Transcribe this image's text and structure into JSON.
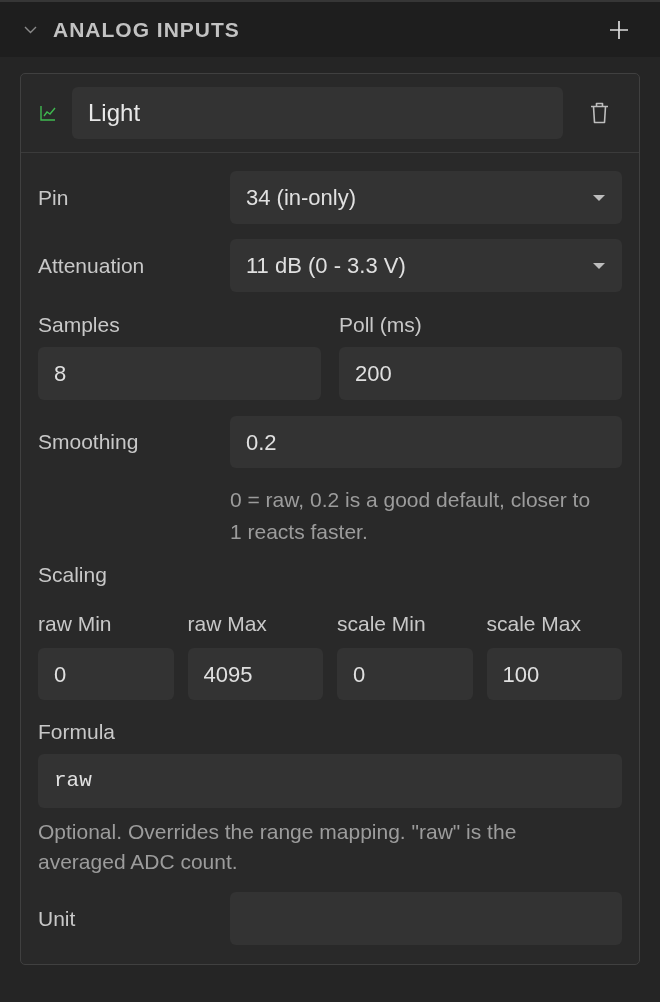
{
  "section": {
    "title": "ANALOG INPUTS",
    "expanded": true
  },
  "card": {
    "name": "Light",
    "pin": {
      "label": "Pin",
      "value": "34 (in-only)"
    },
    "attenuation": {
      "label": "Attenuation",
      "value": "11 dB (0 - 3.3 V)"
    },
    "samples": {
      "label": "Samples",
      "value": "8"
    },
    "poll": {
      "label": "Poll (ms)",
      "value": "200"
    },
    "smoothing": {
      "label": "Smoothing",
      "value": "0.2",
      "help": "0 = raw, 0.2 is a good default, closer to 1 reacts faster."
    },
    "scaling": {
      "label": "Scaling",
      "fields": [
        {
          "label": "raw Min",
          "value": "0"
        },
        {
          "label": "raw Max",
          "value": "4095"
        },
        {
          "label": "scale Min",
          "value": "0"
        },
        {
          "label": "scale Max",
          "value": "100"
        }
      ]
    },
    "formula": {
      "label": "Formula",
      "value": "raw",
      "help": "Optional. Overrides the range mapping. \"raw\" is the averaged ADC count."
    },
    "unit": {
      "label": "Unit"
    }
  }
}
